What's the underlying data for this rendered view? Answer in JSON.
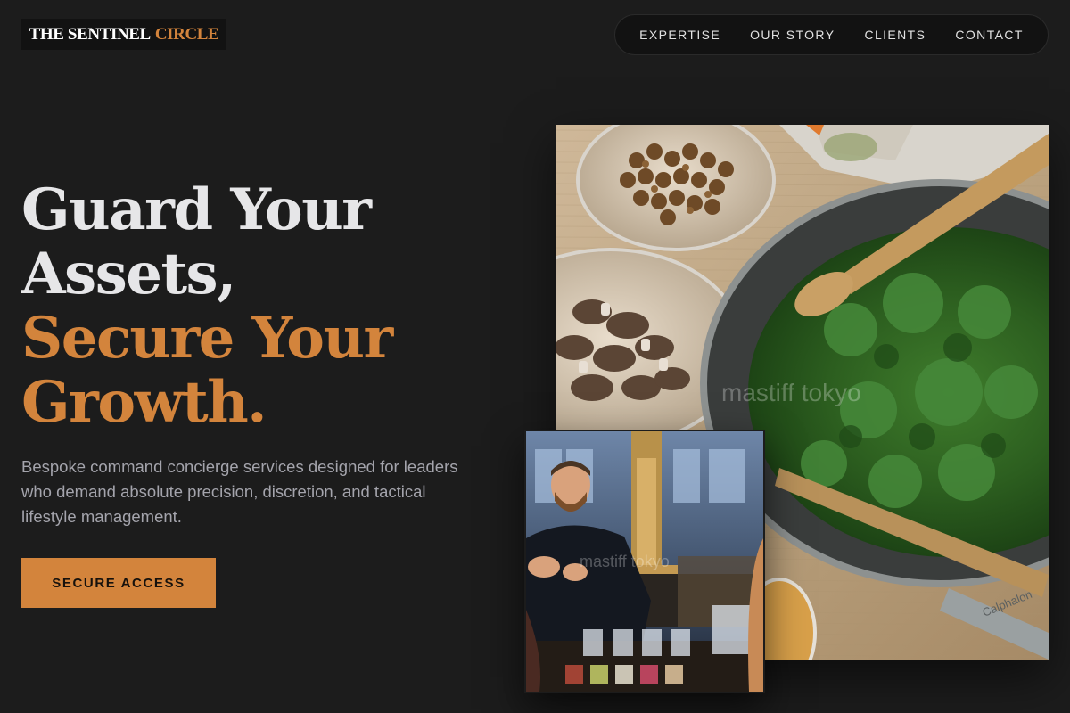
{
  "brand": {
    "name_primary": "THE SENTINEL",
    "name_accent": "CIRCLE"
  },
  "nav": {
    "items": [
      {
        "label": "EXPERTISE"
      },
      {
        "label": "OUR STORY"
      },
      {
        "label": "CLIENTS"
      },
      {
        "label": "CONTACT"
      }
    ]
  },
  "hero": {
    "headline_light": [
      "Guard Your",
      "Assets,"
    ],
    "headline_accent": [
      "Secure Your",
      "Growth."
    ],
    "subtext": "Bespoke command concierge services designed for leaders who demand absolute precision, discretion, and tactical lifestyle management.",
    "cta_label": "SECURE ACCESS"
  },
  "images": {
    "main": {
      "subject": "kitchen-prep-kale-pan-photo",
      "watermark": "mastiff tokyo",
      "pan_brand": "Calphalon"
    },
    "secondary": {
      "subject": "bartender-serving-drinks-photo",
      "watermark": "mastiff tokyo"
    }
  },
  "colors": {
    "background": "#1c1c1c",
    "accent": "#d3843c",
    "text_primary": "#e6e6e8",
    "text_muted": "#a4a4ac",
    "nav_background": "#121212"
  }
}
